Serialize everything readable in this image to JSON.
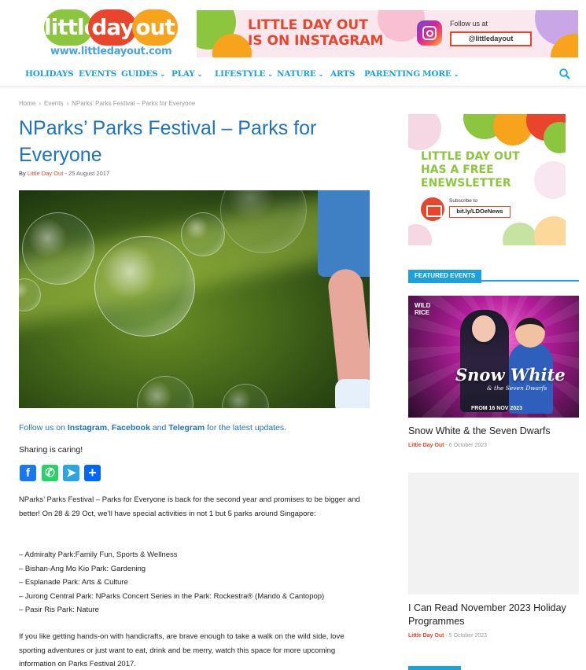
{
  "header": {
    "logo": {
      "word1": "little",
      "word2": "day",
      "word3": "out",
      "url": "www.littledayout.com"
    },
    "banner": {
      "title_line1": "LITTLE DAY OUT",
      "title_line2": "IS ON INSTAGRAM",
      "follow_text": "Follow us at",
      "handle": "@littledayout"
    }
  },
  "nav": {
    "items": [
      {
        "label": "HOLIDAYS",
        "has_dropdown": false
      },
      {
        "label": "EVENTS",
        "has_dropdown": false
      },
      {
        "label": "GUIDES",
        "has_dropdown": true
      },
      {
        "label": "PLAY",
        "has_dropdown": true
      },
      {
        "label": "LIFESTYLE",
        "has_dropdown": true
      },
      {
        "label": "NATURE",
        "has_dropdown": true
      },
      {
        "label": "ARTS",
        "has_dropdown": false
      },
      {
        "label": "PARENTING",
        "has_dropdown": false
      },
      {
        "label": "MORE",
        "has_dropdown": true
      }
    ],
    "chevron": "⌄",
    "search_icon": "search-icon"
  },
  "breadcrumb": {
    "items": [
      "Home",
      "Events",
      "NParks' Parks Festival – Parks for Everyone"
    ],
    "separator": "›"
  },
  "article": {
    "title": "NParks’ Parks Festival – Parks for Everyone",
    "by": "By",
    "author": "Little Day Out",
    "dash": "-",
    "date": "25 August 2017",
    "follow": {
      "prefix": "Follow us on ",
      "instagram": "Instagram",
      "comma": ", ",
      "facebook": "Facebook",
      "and": " and ",
      "telegram": "Telegram",
      "suffix": " for the latest updates."
    },
    "sharing": "Sharing is caring!",
    "share_buttons": [
      {
        "name": "facebook",
        "glyph": "f",
        "color": "#1877f2"
      },
      {
        "name": "whatsapp",
        "glyph": "✆",
        "color": "#25d366"
      },
      {
        "name": "telegram",
        "glyph": "➤",
        "color": "#2ca5e0"
      },
      {
        "name": "share",
        "glyph": "+",
        "color": "#0166ff"
      }
    ],
    "intro": "NParks’ Parks Festival – Parks for Everyone is back for the second year and promises to be bigger and better! On 28 & 29 Oct, we’ll have special activities in not 1 but 5 parks around Singapore:",
    "list": [
      "– Admiralty Park:Family Fun, Sports & Wellness",
      "– Bishan-Ang Mo Kio Park: Gardening",
      "– Esplanade Park: Arts & Culture",
      "– Jurong Central Park: NParks Concert Series in the Park: Rockestra® (Mando & Cantopop)",
      "– Pasir Ris Park: Nature"
    ],
    "outro": "If you like getting hands-on with handicrafts, are brave enough to take a walk on the wild side, love sporting adventures or just want to eat, drink and be merry, watch this space for more upcoming information on Parks Festival 2017."
  },
  "sidebar": {
    "newsletter": {
      "title_line1": "LITTLE DAY OUT",
      "title_line2": "HAS A FREE",
      "title_line3": "ENEWSLETTER",
      "subscribe": "Subscribe to",
      "link": "bit.ly/LDOeNews"
    },
    "featured_header": "FEATURED EVENTS",
    "events": [
      {
        "title": "Snow White & the Seven Dwarfs",
        "author": "Little Day Out",
        "date": "6 October 2023",
        "image_text": {
          "brand": "WILD RICE",
          "title": "Snow White",
          "subtitle": "& the Seven Dwarfs",
          "dates": "FROM 16 NOV 2023"
        }
      },
      {
        "title": "I Can Read November 2023 Holiday Programmes",
        "author": "Little Day Out",
        "date": "5 October 2023"
      }
    ]
  },
  "colors": {
    "nav_blue": "#1aa1de",
    "title_blue": "#1e73be",
    "accent_red": "#e8452c",
    "logo_green": "#8cc63f",
    "logo_orange": "#f7a31c"
  }
}
